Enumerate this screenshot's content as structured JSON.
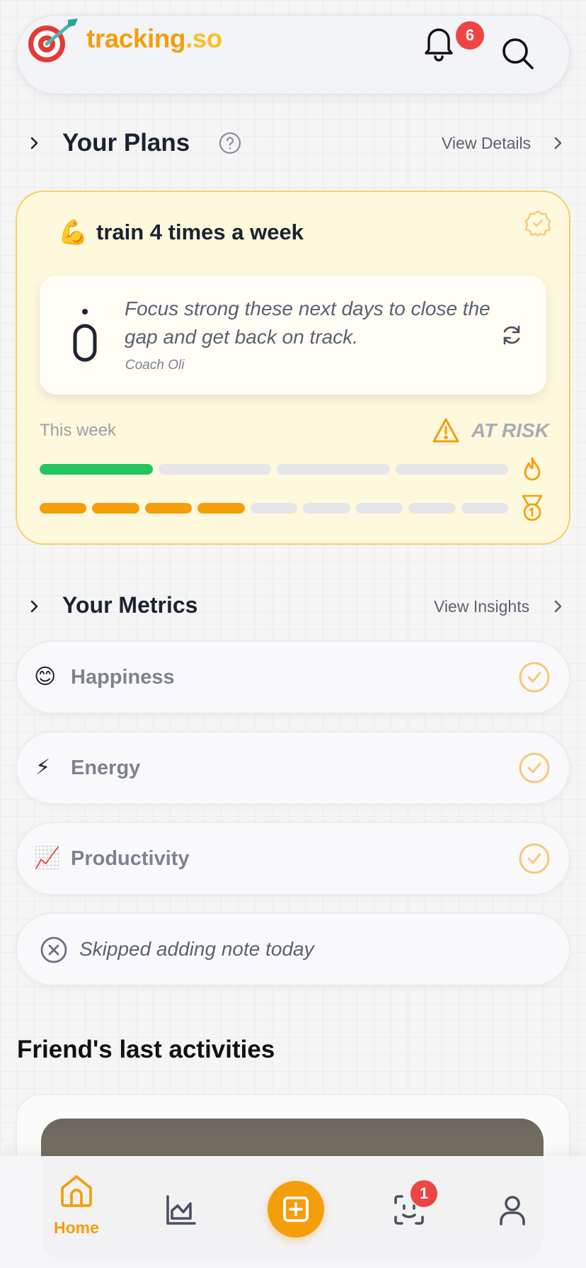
{
  "header": {
    "brand_main": "tracking",
    "brand_suffix": ".so",
    "notification_count": "6",
    "icons": [
      "dart-target-icon",
      "bell-icon",
      "search-icon"
    ]
  },
  "plans": {
    "title": "Your Plans",
    "view_details": "View Details",
    "plan": {
      "emoji": "💪",
      "title": "train 4 times a week",
      "coach_message": "Focus strong these next days to close the gap and get back on track.",
      "coach_name": "Coach Oli",
      "week_label": "This week",
      "status": "AT RISK",
      "week_progress": {
        "segments": 4,
        "filled": 1,
        "color": "#22c55e"
      },
      "streak_progress": {
        "segments": 9,
        "filled": 4,
        "color": "#f59e0b"
      }
    }
  },
  "metrics": {
    "title": "Your Metrics",
    "view_insights": "View Insights",
    "items": [
      {
        "emoji": "😊",
        "label": "Happiness",
        "checked": true
      },
      {
        "emoji": "⚡",
        "label": "Energy",
        "checked": true
      },
      {
        "emoji": "📈",
        "label": "Productivity",
        "checked": true
      }
    ],
    "note": "Skipped adding note today"
  },
  "friends": {
    "title": "Friend's last activities"
  },
  "nav": {
    "home_label": "Home",
    "ai_badge_count": "1",
    "accent": "#f59e0b"
  }
}
